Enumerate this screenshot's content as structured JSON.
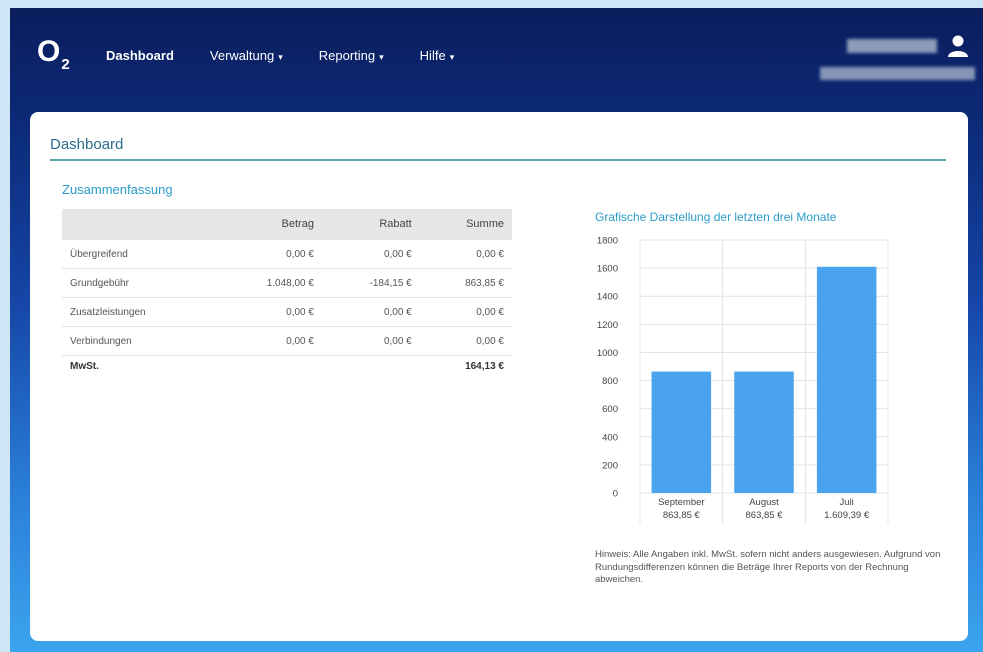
{
  "header": {
    "logo": "O",
    "logo_sub": "2",
    "nav": [
      {
        "label": "Dashboard",
        "active": true,
        "dropdown": false
      },
      {
        "label": "Verwaltung",
        "active": false,
        "dropdown": true
      },
      {
        "label": "Reporting",
        "active": false,
        "dropdown": true
      },
      {
        "label": "Hilfe",
        "active": false,
        "dropdown": true
      }
    ],
    "user_icon": "user-icon"
  },
  "panel": {
    "title": "Dashboard",
    "summary": {
      "title": "Zusammenfassung",
      "columns": [
        "",
        "Betrag",
        "Rabatt",
        "Summe"
      ],
      "rows": [
        [
          "Übergreifend",
          "0,00 €",
          "0,00 €",
          "0,00 €"
        ],
        [
          "Grundgebühr",
          "1.048,00 €",
          "-184,15 €",
          "863,85 €"
        ],
        [
          "Zusatzleistungen",
          "0,00 €",
          "0,00 €",
          "0,00 €"
        ],
        [
          "Verbindungen",
          "0,00 €",
          "0,00 €",
          "0,00 €"
        ]
      ],
      "mwst_label": "MwSt.",
      "mwst_value": "164,13 €"
    },
    "chart_title": "Grafische Darstellung der letzten drei Monate",
    "hint": "Hinweis: Alle Angaben inkl. MwSt. sofern nicht anders ausgewiesen. Aufgrund von Rundungsdifferenzen können die Beträge Ihrer Reports von der Rechnung abweichen."
  },
  "chart_data": {
    "type": "bar",
    "categories": [
      "September",
      "August",
      "Juli"
    ],
    "value_labels": [
      "863,85 €",
      "863,85 €",
      "1.609,39 €"
    ],
    "values": [
      863.85,
      863.85,
      1609.39
    ],
    "ylim": [
      0,
      1800
    ],
    "yticks": [
      0,
      200,
      400,
      600,
      800,
      1000,
      1200,
      1400,
      1600,
      1800
    ],
    "bar_color": "#4aa3ee",
    "grid": true
  }
}
